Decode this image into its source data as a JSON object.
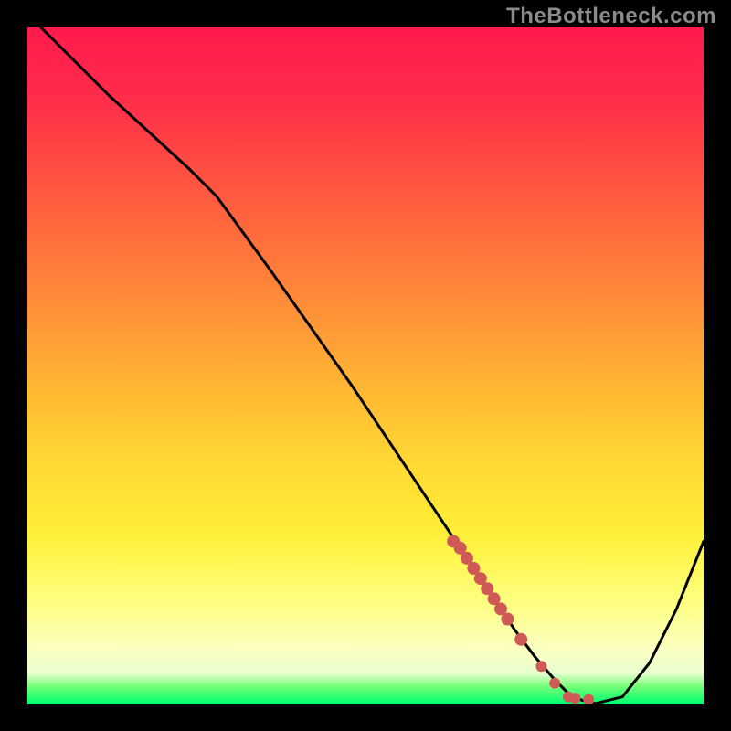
{
  "attribution": "TheBottleneck.com",
  "chart_data": {
    "type": "line",
    "title": "",
    "xlabel": "",
    "ylabel": "",
    "xlim": [
      0,
      100
    ],
    "ylim": [
      0,
      100
    ],
    "grid": false,
    "legend": false,
    "series": [
      {
        "name": "curve",
        "color": "#000000",
        "x": [
          2,
          12,
          24,
          28,
          36,
          48,
          60,
          64,
          68,
          72,
          75,
          78,
          80,
          82,
          84,
          88,
          92,
          96,
          100
        ],
        "y": [
          100,
          90,
          79,
          75,
          64,
          47,
          29,
          23,
          17,
          11,
          7,
          3.5,
          1.5,
          0.5,
          0,
          1,
          6,
          14,
          24
        ]
      },
      {
        "name": "highlight-dots",
        "color": "#cf5a55",
        "style": "marker",
        "x": [
          63,
          64,
          65,
          66,
          67,
          68,
          69,
          70,
          71,
          73,
          76,
          78,
          80,
          81,
          83
        ],
        "y": [
          24,
          23,
          21.5,
          20,
          18.5,
          17,
          15.5,
          14,
          12.5,
          9.5,
          5.5,
          3,
          1,
          0.8,
          0.6
        ]
      }
    ],
    "background": {
      "type": "vertical-gradient",
      "stops": [
        {
          "pos": 0,
          "color": "#ff1a4d"
        },
        {
          "pos": 0.4,
          "color": "#ff8a38"
        },
        {
          "pos": 0.75,
          "color": "#fff037"
        },
        {
          "pos": 0.95,
          "color": "#e9ffd0"
        },
        {
          "pos": 1.0,
          "color": "#00ff70"
        }
      ]
    }
  }
}
